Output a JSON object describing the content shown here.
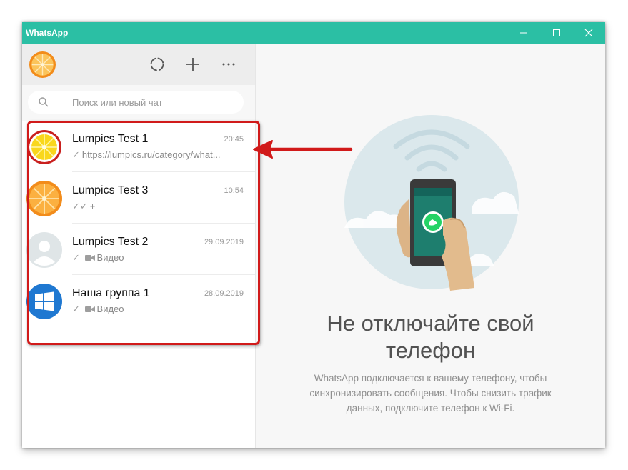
{
  "window": {
    "title": "WhatsApp",
    "controls": [
      "minimize",
      "maximize",
      "close"
    ]
  },
  "sidebar": {
    "header": {
      "avatar": "orange-slice-avatar",
      "buttons": [
        {
          "name": "status-button",
          "icon": "status-ring-icon"
        },
        {
          "name": "new-chat-button",
          "icon": "plus-icon"
        },
        {
          "name": "menu-button",
          "icon": "more-horizontal-icon"
        }
      ]
    },
    "search": {
      "placeholder": "Поиск или новый чат"
    },
    "chats": [
      {
        "name": "Lumpics Test 1",
        "time": "20:45",
        "preview": "https://lumpics.ru/category/what...",
        "status": "single-check",
        "media": "",
        "avatar": "lemon-slice-avatar"
      },
      {
        "name": "Lumpics Test 3",
        "time": "10:54",
        "preview": "+",
        "status": "double-check",
        "media": "",
        "avatar": "orange-slice-avatar"
      },
      {
        "name": "Lumpics Test 2",
        "time": "29.09.2019",
        "preview": "Видео",
        "status": "single-check",
        "media": "video-icon",
        "avatar": "default-avatar"
      },
      {
        "name": "Наша группа 1",
        "time": "28.09.2019",
        "preview": "Видео",
        "status": "single-check",
        "media": "video-icon",
        "avatar": "windows-logo-avatar"
      }
    ]
  },
  "main": {
    "title_line1": "Не отключайте свой",
    "title_line2": "телефон",
    "description_line1": "WhatsApp подключается к вашему телефону, чтобы",
    "description_line2": "синхронизировать сообщения. Чтобы снизить трафик",
    "description_line3": "данных, подключите телефон к Wi-Fi."
  },
  "annotation": {
    "highlight_color": "#d11a1a"
  },
  "colors": {
    "titlebar": "#2bbfa4",
    "accent": "#25d366",
    "highlight": "#d11a1a"
  }
}
